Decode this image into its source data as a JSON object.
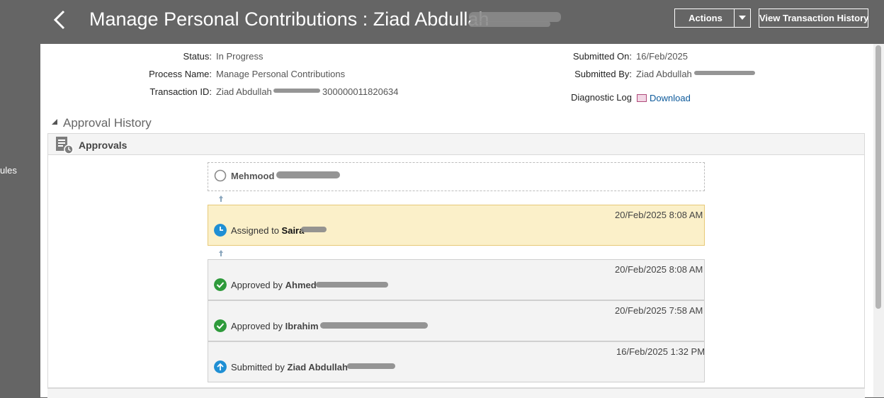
{
  "rail": {
    "text": "ules"
  },
  "header": {
    "title": "Manage Personal Contributions : Ziad Abdullah",
    "actions_label": "Actions",
    "view_history_label": "View Transaction History"
  },
  "details": {
    "status_label": "Status:",
    "status_value": "In Progress",
    "process_label": "Process Name:",
    "process_value": "Manage Personal Contributions",
    "txn_label": "Transaction ID:",
    "txn_value_a": "Ziad Abdullah",
    "txn_value_b": "300000011820634",
    "submitted_on_label": "Submitted On:",
    "submitted_on_value": "16/Feb/2025",
    "submitted_by_label": "Submitted By:",
    "submitted_by_value": "Ziad Abdullah",
    "diag_label": "Diagnostic Log",
    "diag_link": "Download"
  },
  "approval_history": {
    "title": "Approval History",
    "approvals_title": "Approvals",
    "items": [
      {
        "name": "Mehmood",
        "state": "pending"
      },
      {
        "time": "20/Feb/2025 8:08 AM",
        "prefix": "Assigned to ",
        "name": "Saira",
        "state": "assigned"
      },
      {
        "time": "20/Feb/2025 8:08 AM",
        "prefix": "Approved by ",
        "name": "Ahmed",
        "state": "approved"
      },
      {
        "time": "20/Feb/2025 7:58 AM",
        "prefix": "Approved by ",
        "name": "Ibrahim",
        "state": "approved"
      },
      {
        "time": "16/Feb/2025 1:32 PM",
        "prefix": "Submitted by ",
        "name": "Ziad Abdullah",
        "state": "submitted"
      }
    ]
  },
  "colors": {
    "topbar": "#656565",
    "assigned_bg": "#fbf0c9",
    "approved_green": "#2e9a3b",
    "clock_blue": "#1f8fd4",
    "link": "#0d5a9b"
  },
  "icons": [
    "back-chevron-icon",
    "dropdown-caret-icon",
    "download-icon",
    "collapse-triangle-icon",
    "approvals-list-icon",
    "pending-circle-icon",
    "clock-icon",
    "check-icon",
    "arrow-up-icon"
  ]
}
